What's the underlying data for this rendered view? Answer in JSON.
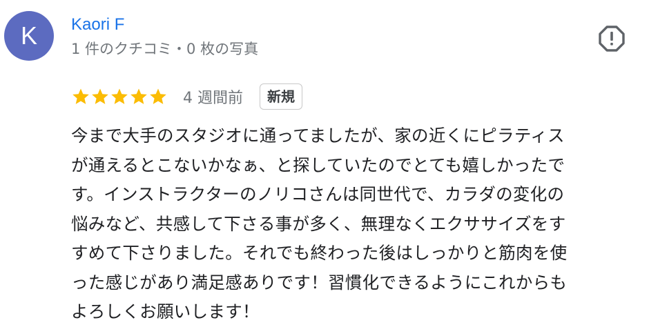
{
  "reviewer": {
    "avatar_initial": "K",
    "avatar_color": "#5c6bc0",
    "name": "Kaori F",
    "meta": "1 件のクチコミ・0 枚の写真"
  },
  "report": {
    "icon": "report-flag-icon"
  },
  "review": {
    "rating": 5,
    "rating_max": 5,
    "star_color": "#fbbc04",
    "timestamp": "4 週間前",
    "badge": "新規",
    "lines": [
      "今まで大手のスタジオに通ってましたが、家の近くにピラティス",
      "が通えるとこないかなぁ、と探していたのでとても嬉しかったで",
      "す。インストラクターのノリコさんは同世代で、カラダの変化の",
      "悩みなど、共感して下さる事が多く、無理なくエクササイズをす",
      "すめて下さりました。それでも終わった後はしっかりと筋肉を使",
      "った感じがあり満足感ありです！習慣化できるようにこれからも",
      "よろしくお願いします！"
    ]
  }
}
